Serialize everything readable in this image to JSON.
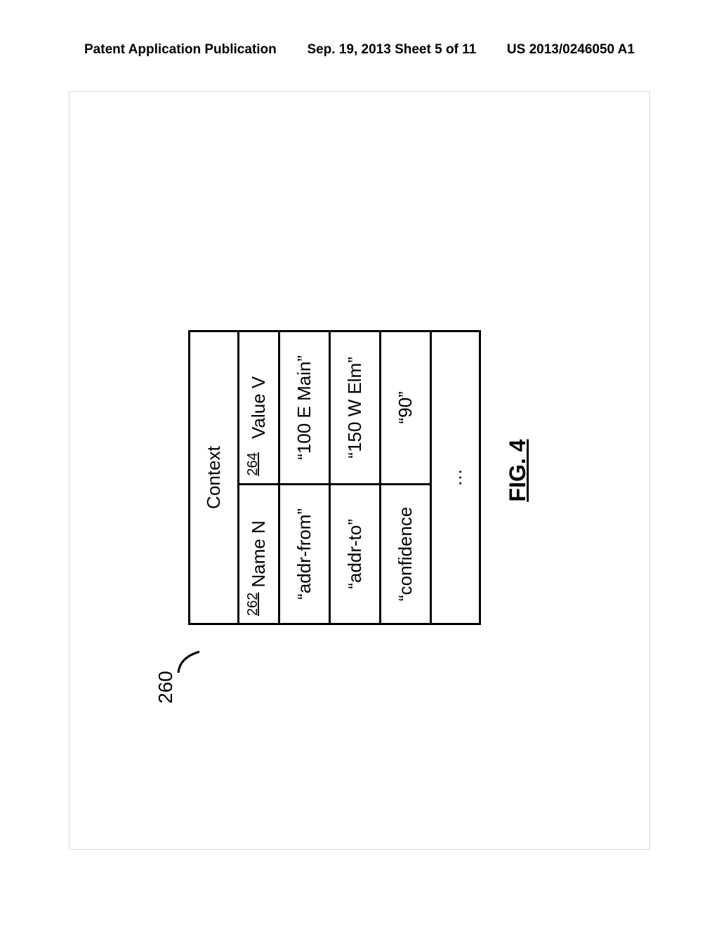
{
  "header": {
    "left": "Patent Application Publication",
    "center": "Sep. 19, 2013  Sheet 5 of 11",
    "right": "US 2013/0246050 A1"
  },
  "diagram": {
    "ref": "260",
    "title": "Context",
    "col1_ref": "262",
    "col1_label": "Name N",
    "col2_ref": "264",
    "col2_label": "Value V",
    "rows": [
      {
        "name": "“addr-from”",
        "value": "“100 E Main”"
      },
      {
        "name": "“addr-to”",
        "value": "“150 W Elm”"
      },
      {
        "name": "“confidence",
        "value": "“90”"
      }
    ],
    "ellipsis": "…",
    "figure_label": "FIG. 4"
  }
}
